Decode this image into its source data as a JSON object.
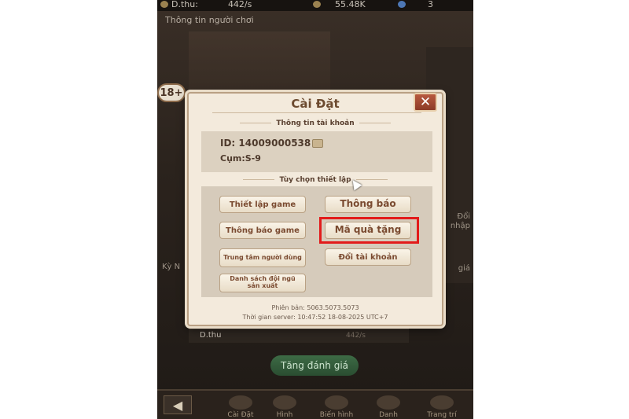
{
  "topbar": {
    "revenue_label": "D.thu:",
    "revenue_rate": "442/s",
    "gold": "55.48K",
    "gems": "3"
  },
  "screen": {
    "subtitle": "Thông tin người chơi",
    "age_badge": "18+",
    "side_left": "Kỳ N",
    "side_right_1": "Đổi",
    "side_right_2": "nhập",
    "side_right_3": "giá",
    "bar_label": "D.thu",
    "bar_value": "442/s",
    "rate_button": "Tăng đánh giá",
    "bottom_nav": [
      "Cài Đặt",
      "Hình Dáng",
      "Biến hình",
      "Danh hiệu",
      "Trang trí"
    ]
  },
  "dialog": {
    "title": "Cài Đặt",
    "close_label": "✕",
    "account_section": "Thông tin tài khoản",
    "account_id": "ID: 14009000538",
    "account_cluster": "Cụm:S-9",
    "options_section": "Tùy chọn thiết lập",
    "buttons": {
      "game_settings": "Thiết lập game",
      "notifications": "Thông báo",
      "game_notices": "Thông báo game",
      "gift_code": "Mã quà tặng",
      "user_center": "Trung tâm người dùng",
      "switch_account": "Đổi tài khoản",
      "credits": "Danh sách đội ngũ sản xuất"
    },
    "version": "Phiên bản: 5063.5073.5073",
    "server_time": "Thời gian server: 10:47:52 18-08-2025 UTC+7"
  },
  "colors": {
    "highlight": "#e21b1b",
    "dialog_bg": "#f3eadc",
    "button_text": "#7a4a30",
    "close_button": "#a04a33"
  }
}
